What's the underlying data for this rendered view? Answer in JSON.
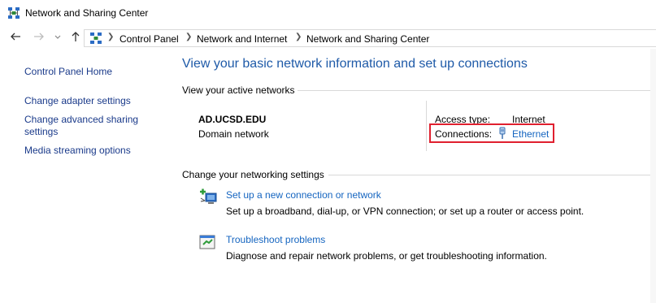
{
  "window": {
    "title": "Network and Sharing Center"
  },
  "address_bar": {
    "breadcrumbs": [
      "Control Panel",
      "Network and Internet",
      "Network and Sharing Center"
    ]
  },
  "sidebar": {
    "items": [
      {
        "label": "Control Panel Home"
      },
      {
        "label": "Change adapter settings"
      },
      {
        "label": "Change advanced sharing settings"
      },
      {
        "label": "Media streaming options"
      }
    ]
  },
  "main": {
    "title": "View your basic network information and set up connections",
    "active_networks_label": "View your active networks",
    "network": {
      "name": "AD.UCSD.EDU",
      "type": "Domain network",
      "access_type_label": "Access type:",
      "access_type_value": "Internet",
      "connections_label": "Connections:",
      "connections_value": "Ethernet"
    },
    "change_settings_label": "Change your networking settings",
    "tasks": [
      {
        "icon": "new-connection-icon",
        "link": "Set up a new connection or network",
        "description": "Set up a broadband, dial-up, or VPN connection; or set up a router or access point."
      },
      {
        "icon": "troubleshoot-icon",
        "link": "Troubleshoot problems",
        "description": "Diagnose and repair network problems, or get troubleshooting information."
      }
    ]
  },
  "colors": {
    "link": "#1565c0",
    "heading": "#1e5aa8",
    "highlight_border": "#e0202f"
  }
}
